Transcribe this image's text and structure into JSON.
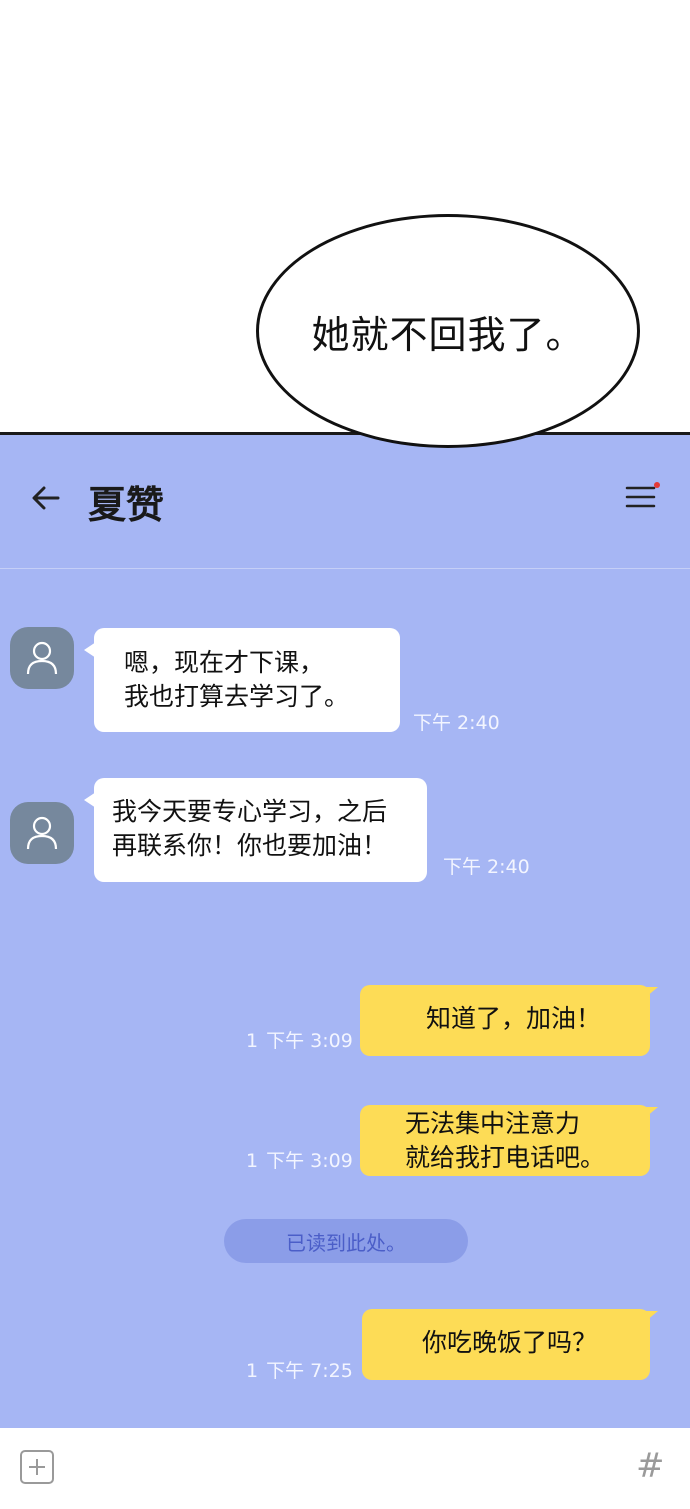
{
  "caption": {
    "speech": "她就不回我了。"
  },
  "header": {
    "title": "夏赞",
    "back_icon": "arrow-left-icon",
    "menu_icon": "hamburger-menu-icon",
    "notification_dot_color": "#e53935"
  },
  "messages": [
    {
      "from": "contact",
      "lines": [
        "嗯，现在才下课，",
        "我也打算去学习了。"
      ],
      "time": "下午 2:40"
    },
    {
      "from": "contact",
      "lines": [
        "我今天要专心学习，之后",
        "再联系你！你也要加油！"
      ],
      "time": "下午 2:40"
    },
    {
      "from": "me",
      "lines": [
        "知道了，加油！"
      ],
      "unread": "1",
      "time": "下午 3:09"
    },
    {
      "from": "me",
      "lines": [
        "无法集中注意力",
        "就给我打电话吧。"
      ],
      "unread": "1",
      "time": "下午 3:09"
    },
    {
      "from": "me",
      "lines": [
        "你吃晚饭了吗？"
      ],
      "unread": "1",
      "time": "下午 7:25"
    }
  ],
  "read_marker": "已读到此处。",
  "input_bar": {
    "plus_icon": "plus-square-icon",
    "hash_icon": "hash-icon",
    "hash": "#"
  },
  "colors": {
    "chat_bg": "#a6b6f4",
    "incoming": "#ffffff",
    "outgoing": "#fddc56",
    "avatar": "#76889d"
  }
}
